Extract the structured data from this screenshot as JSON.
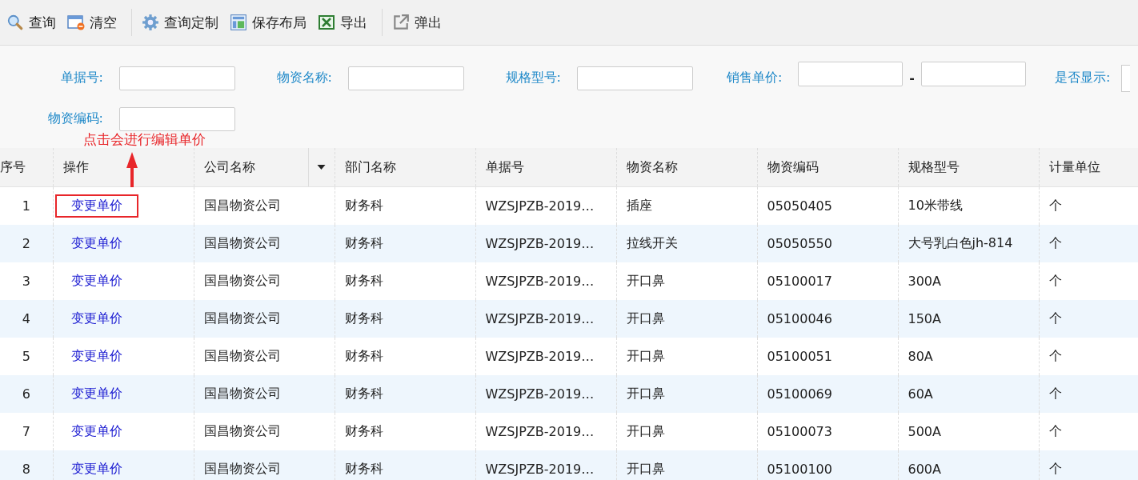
{
  "toolbar": [
    {
      "kind": "search",
      "label": "查询"
    },
    {
      "kind": "clear",
      "label": "清空",
      "divider_after": true
    },
    {
      "kind": "gear",
      "label": "查询定制"
    },
    {
      "kind": "layout",
      "label": "保存布局"
    },
    {
      "kind": "excel",
      "label": "导出",
      "divider_after": true
    },
    {
      "kind": "popout",
      "label": "弹出"
    }
  ],
  "filters": [
    {
      "kind": "text",
      "label": "单据号:"
    },
    {
      "kind": "text",
      "label": "物资名称:"
    },
    {
      "kind": "text",
      "label": "规格型号:"
    },
    {
      "kind": "range",
      "label": "销售单价:",
      "separator": "-"
    },
    {
      "kind": "select",
      "label": "是否显示:"
    },
    {
      "kind": "text",
      "label": "物资编码:"
    }
  ],
  "annotation": {
    "text": "点击会进行编辑单价"
  },
  "table": {
    "columns": [
      {
        "label": "序号"
      },
      {
        "label": "操作"
      },
      {
        "label": "公司名称",
        "menu": true
      },
      {
        "label": "部门名称"
      },
      {
        "label": "单据号"
      },
      {
        "label": "物资名称"
      },
      {
        "label": "物资编码"
      },
      {
        "label": "规格型号"
      },
      {
        "label": "计量单位"
      }
    ],
    "rows": [
      {
        "highlighted": true,
        "cells": [
          "1",
          "变更单价",
          "国昌物资公司",
          "财务科",
          "WZSJPZB-2019…",
          "插座",
          "05050405",
          "10米带线",
          "个"
        ]
      },
      {
        "highlighted": false,
        "cells": [
          "2",
          "变更单价",
          "国昌物资公司",
          "财务科",
          "WZSJPZB-2019…",
          "拉线开关",
          "05050550",
          "大号乳白色jh-814",
          "个"
        ]
      },
      {
        "highlighted": false,
        "cells": [
          "3",
          "变更单价",
          "国昌物资公司",
          "财务科",
          "WZSJPZB-2019…",
          "开口鼻",
          "05100017",
          "300A",
          "个"
        ]
      },
      {
        "highlighted": false,
        "cells": [
          "4",
          "变更单价",
          "国昌物资公司",
          "财务科",
          "WZSJPZB-2019…",
          "开口鼻",
          "05100046",
          "150A",
          "个"
        ]
      },
      {
        "highlighted": false,
        "cells": [
          "5",
          "变更单价",
          "国昌物资公司",
          "财务科",
          "WZSJPZB-2019…",
          "开口鼻",
          "05100051",
          "80A",
          "个"
        ]
      },
      {
        "highlighted": false,
        "cells": [
          "6",
          "变更单价",
          "国昌物资公司",
          "财务科",
          "WZSJPZB-2019…",
          "开口鼻",
          "05100069",
          "60A",
          "个"
        ]
      },
      {
        "highlighted": false,
        "cells": [
          "7",
          "变更单价",
          "国昌物资公司",
          "财务科",
          "WZSJPZB-2019…",
          "开口鼻",
          "05100073",
          "500A",
          "个"
        ]
      },
      {
        "highlighted": false,
        "cells": [
          "8",
          "变更单价",
          "国昌物资公司",
          "财务科",
          "WZSJPZB-2019…",
          "开口鼻",
          "05100100",
          "600A",
          "个"
        ]
      }
    ]
  }
}
